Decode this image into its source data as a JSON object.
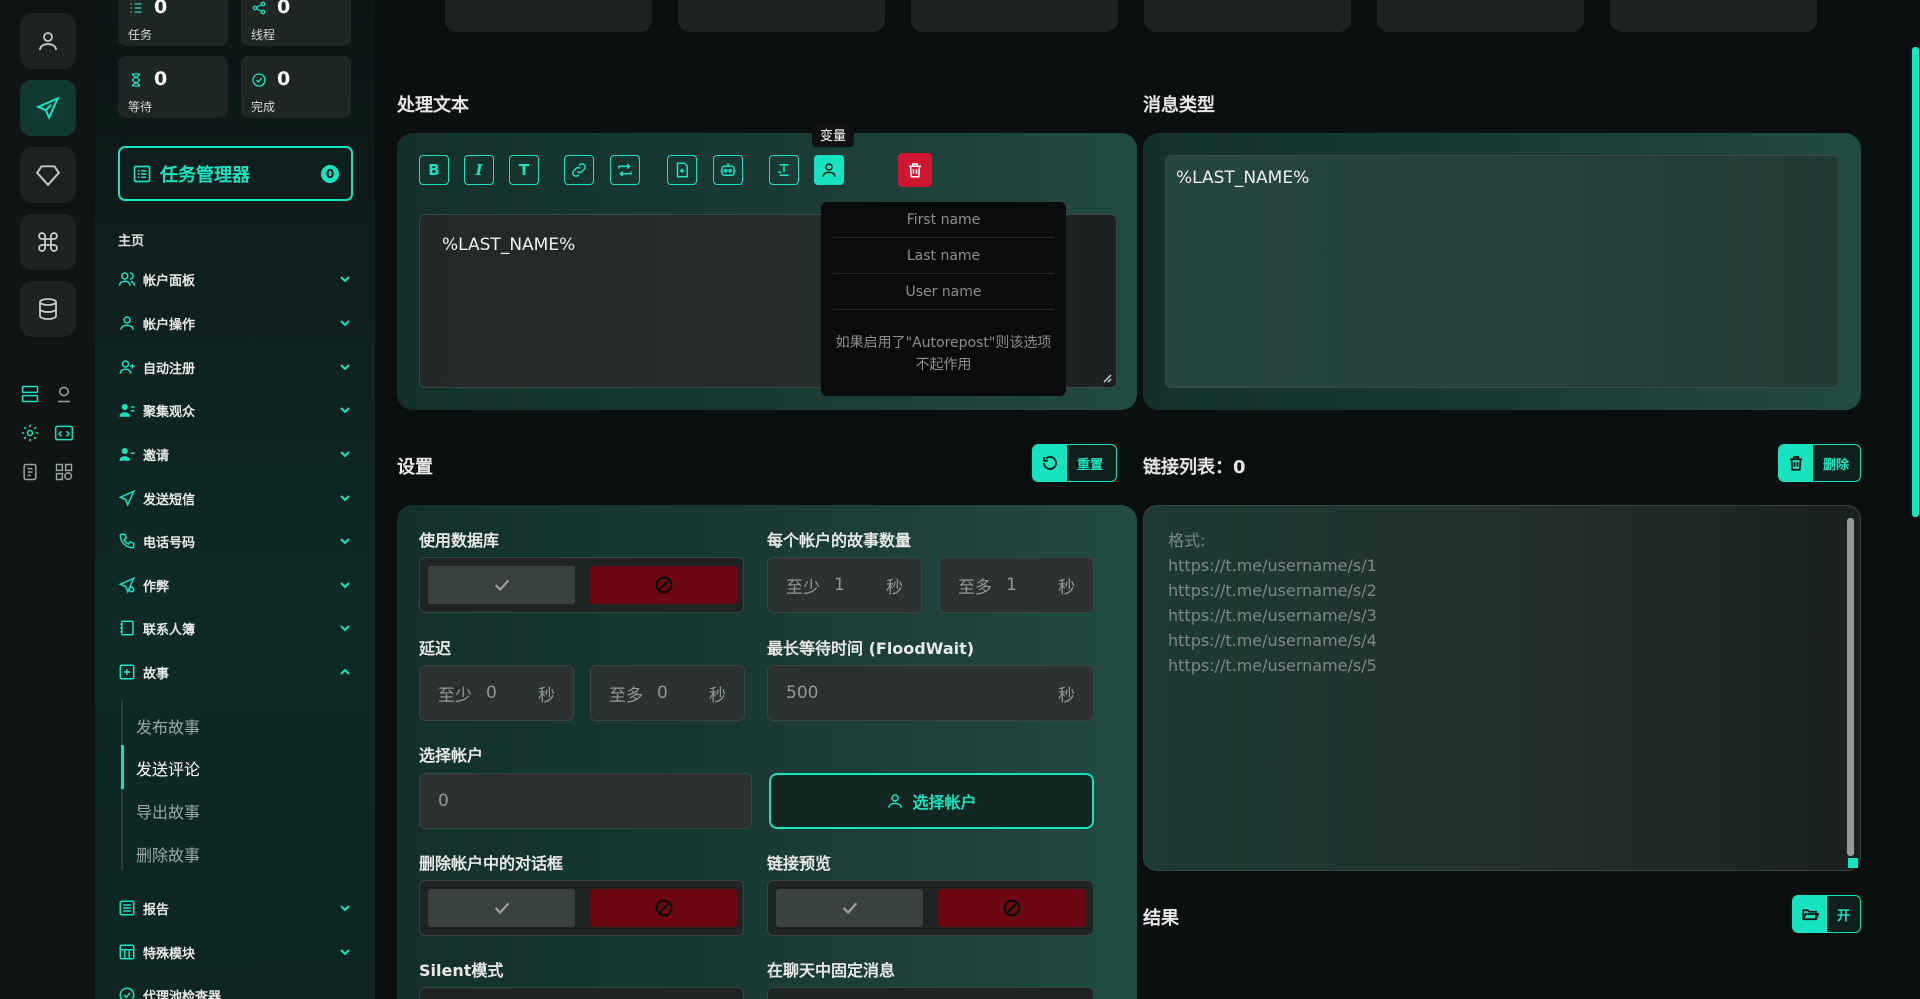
{
  "stats": {
    "tasks": {
      "value": "0",
      "label": "任务"
    },
    "threads": {
      "value": "0",
      "label": "线程"
    },
    "waiting": {
      "value": "0",
      "label": "等待"
    },
    "done": {
      "value": "0",
      "label": "完成"
    }
  },
  "task_manager": {
    "label": "任务管理器",
    "count": "0"
  },
  "sidebar": {
    "home_label": "主页",
    "items": [
      {
        "label": "帐户面板",
        "icon": "users-icon"
      },
      {
        "label": "帐户操作",
        "icon": "user-icon"
      },
      {
        "label": "自动注册",
        "icon": "user-plus-icon"
      },
      {
        "label": "聚集观众",
        "icon": "users-gather-icon"
      },
      {
        "label": "邀请",
        "icon": "user-invite-icon"
      },
      {
        "label": "发送短信",
        "icon": "send-icon"
      },
      {
        "label": "电话号码",
        "icon": "phone-icon"
      },
      {
        "label": "作弊",
        "icon": "cheat-icon"
      },
      {
        "label": "联系人簿",
        "icon": "contacts-icon"
      },
      {
        "label": "故事",
        "icon": "story-icon"
      },
      {
        "label": "报告",
        "icon": "report-icon"
      },
      {
        "label": "特殊模块",
        "icon": "module-icon"
      },
      {
        "label": "代理池检查器",
        "icon": "proxy-icon"
      }
    ],
    "story_sub": [
      {
        "label": "发布故事",
        "active": false
      },
      {
        "label": "发送评论",
        "active": true
      },
      {
        "label": "导出故事",
        "active": false
      },
      {
        "label": "删除故事",
        "active": false
      }
    ]
  },
  "process_text": {
    "title": "处理文本",
    "tooltip": "变量",
    "text": "%LAST_NAME%",
    "toolbar": [
      "bold",
      "italic",
      "text",
      "link",
      "repost",
      "file",
      "bot",
      "format",
      "variable",
      "delete"
    ],
    "variables": [
      "First name",
      "Last name",
      "User name"
    ],
    "note": "如果启用了\"Autorepost\"则该选项不起作用"
  },
  "message_type": {
    "title": "消息类型",
    "text": "%LAST_NAME%"
  },
  "settings": {
    "title": "设置",
    "reset_label": "重置",
    "use_db_label": "使用数据库",
    "stories_per_account_label": "每个帐户的故事数量",
    "min_label": "至少",
    "max_label": "至多",
    "sec_label": "秒",
    "stories_min": "1",
    "stories_max": "1",
    "delay_label": "延迟",
    "delay_min": "0",
    "delay_max": "0",
    "floodwait_label": "最长等待时间 (FloodWait)",
    "floodwait_value": "500",
    "select_account_label": "选择帐户",
    "select_account_value": "0",
    "select_account_button": "选择帐户",
    "delete_dialogs_label": "删除帐户中的对话框",
    "link_preview_label": "链接预览",
    "silent_label": "Silent模式",
    "pin_label": "在聊天中固定消息"
  },
  "links": {
    "title": "链接列表：0",
    "delete_label": "删除",
    "placeholder_lines": [
      "格式:",
      "https://t.me/username/s/1",
      "https://t.me/username/s/2",
      "https://t.me/username/s/3",
      "https://t.me/username/s/4",
      "https://t.me/username/s/5"
    ]
  },
  "results": {
    "title": "结果",
    "open_label": "开"
  },
  "colors": {
    "accent": "#17e3c0",
    "danger": "#d1172f",
    "danger_dark": "#6c0713"
  }
}
